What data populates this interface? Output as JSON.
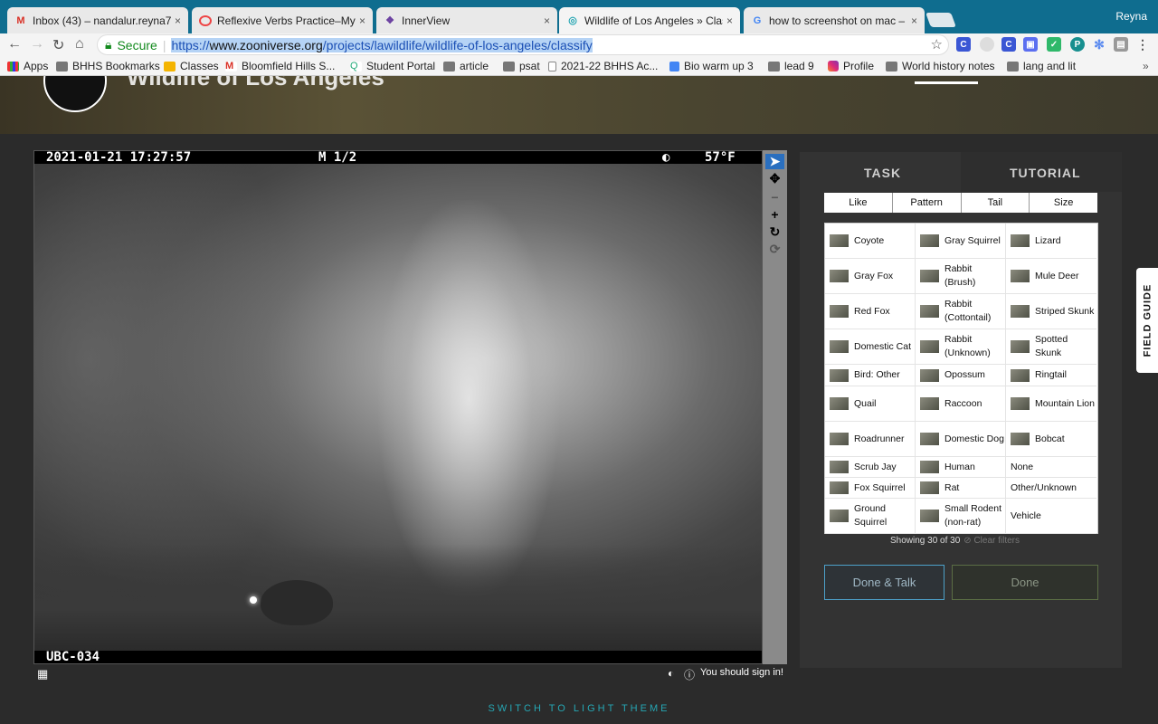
{
  "browser": {
    "tabs": [
      {
        "title": "Inbox (43) – nandalur.reyna7",
        "icon": "gmail-icon",
        "active": false
      },
      {
        "title": "Reflexive Verbs Practice–Myst",
        "icon": "quiz-icon",
        "active": false
      },
      {
        "title": "InnerView",
        "icon": "innerview-icon",
        "active": false
      },
      {
        "title": "Wildlife of Los Angeles » Class",
        "icon": "zooniverse-icon",
        "active": true
      },
      {
        "title": "how to screenshot on mac – G",
        "icon": "google-icon",
        "active": false
      }
    ],
    "tab_close": "×",
    "user_name": "Reyna",
    "secure_label": "Secure",
    "url_scheme": "https://",
    "url_host": "www.zooniverse.org",
    "url_path": "/projects/lawildlife/wildlife-of-los-angeles/classify",
    "bookmarks": [
      {
        "label": "Apps",
        "icon": "apps-icon"
      },
      {
        "label": "BHHS Bookmarks",
        "icon": "folder-icon"
      },
      {
        "label": "Classes",
        "icon": "classroom-icon"
      },
      {
        "label": "Bloomfield Hills S...",
        "icon": "gmail-icon"
      },
      {
        "label": "Student Portal",
        "icon": "portal-icon"
      },
      {
        "label": "article",
        "icon": "folder-icon"
      },
      {
        "label": "psat",
        "icon": "folder-icon"
      },
      {
        "label": "2021-22 BHHS Ac...",
        "icon": "doc-icon"
      },
      {
        "label": "Bio warm up 3",
        "icon": "docs-icon"
      },
      {
        "label": "lead 9",
        "icon": "folder-icon"
      },
      {
        "label": "Profile",
        "icon": "instagram-icon"
      },
      {
        "label": "World history notes",
        "icon": "folder-icon"
      },
      {
        "label": "lang and lit",
        "icon": "folder-icon"
      }
    ],
    "bookmarks_more": "»"
  },
  "project": {
    "title": "Wildlife of Los Angeles"
  },
  "subject": {
    "timestamp": "2021-01-21  17:27:57",
    "mode": "M 1/2",
    "temperature": "57°F",
    "camera_id": "UBC-034",
    "sign_in_note": "You should sign in!"
  },
  "tools": [
    {
      "name": "pointer-tool",
      "glyph": "➤"
    },
    {
      "name": "move-tool",
      "glyph": "✥"
    },
    {
      "name": "zoom-out-tool",
      "glyph": "−"
    },
    {
      "name": "zoom-in-tool",
      "glyph": "+"
    },
    {
      "name": "rotate-tool",
      "glyph": "↻"
    },
    {
      "name": "reset-tool",
      "glyph": "⟳"
    }
  ],
  "panel": {
    "task_tab": "TASK",
    "tutorial_tab": "TUTORIAL",
    "filters": [
      "Like",
      "Pattern",
      "Tail",
      "Size"
    ],
    "species": [
      [
        "Coyote",
        "Gray Squirrel",
        "Lizard"
      ],
      [
        "Gray Fox",
        "Rabbit (Brush)",
        "Mule Deer"
      ],
      [
        "Red Fox",
        "Rabbit (Cottontail)",
        "Striped Skunk"
      ],
      [
        "Domestic Cat",
        "Rabbit (Unknown)",
        "Spotted Skunk"
      ],
      [
        "Bird: Other",
        "Opossum",
        "Ringtail"
      ],
      [
        "Quail",
        "Raccoon",
        "Mountain Lion"
      ],
      [
        "Roadrunner",
        "Domestic Dog",
        "Bobcat"
      ],
      [
        "Scrub Jay",
        "Human",
        "None"
      ],
      [
        "Fox Squirrel",
        "Rat",
        "Other/Unknown"
      ],
      [
        "Ground Squirrel",
        "Small Rodent (non-rat)",
        "Vehicle"
      ]
    ],
    "showing": "Showing 30 of 30",
    "clear_filters": "⊘ Clear filters",
    "done_talk": "Done & Talk",
    "done": "Done"
  },
  "field_guide": "FIELD GUIDE",
  "theme_switch": "SWITCH TO LIGHT THEME",
  "colors": {
    "accent": "#26a6b3",
    "tabbar": "#0f6d8f",
    "secure": "#138a1e"
  }
}
